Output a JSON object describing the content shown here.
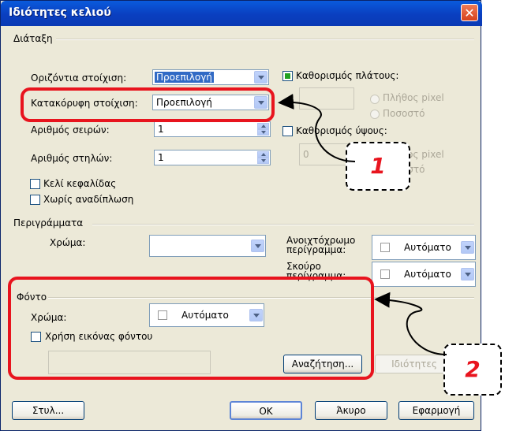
{
  "window": {
    "title": "Ιδιότητες κελιού",
    "close_icon": "close-icon"
  },
  "layout_section": {
    "heading": "Διάταξη",
    "horizontal_align": {
      "label": "Οριζόντια στοίχιση:",
      "value": "Προεπιλογή"
    },
    "vertical_align": {
      "label": "Κατακόρυφη στοίχιση:",
      "value": "Προεπιλογή"
    },
    "rows": {
      "label": "Αριθμός σειρών:",
      "value": "1"
    },
    "cols": {
      "label": "Αριθμός στηλών:",
      "value": "1"
    },
    "header_cell": {
      "label": "Κελί κεφαλίδας",
      "checked": false
    },
    "no_wrap": {
      "label": "Χωρίς αναδίπλωση",
      "checked": false
    },
    "set_width": {
      "label": "Καθορισμός πλάτους:",
      "checked": true,
      "value": ""
    },
    "width_pixels": "Πλήθος pixel",
    "width_percent": "Ποσοστό",
    "set_height": {
      "label": "Καθορισμός ύψους:",
      "checked": false,
      "value": "0"
    },
    "height_pixels": "Πλήθος pixel",
    "height_percent": "Ποσοστό"
  },
  "borders_section": {
    "heading": "Περιγράμματα",
    "color": {
      "label": "Χρώμα:",
      "value": ""
    },
    "light_border": {
      "label_line1": "Ανοιχτόχρωμο",
      "label_line2": "περίγραμμα:",
      "value": "Αυτόματο"
    },
    "dark_border": {
      "label_line1": "Σκούρο",
      "label_line2": "περίγραμμα:",
      "value": "Αυτόματο"
    }
  },
  "background_section": {
    "heading": "Φόντο",
    "color": {
      "label": "Χρώμα:",
      "value": "Αυτόματο"
    },
    "use_image": {
      "label": "Χρήση εικόνας φόντου",
      "checked": false
    },
    "image_path": "",
    "browse_button": "Αναζήτηση...",
    "properties_button": "Ιδιότητες"
  },
  "footer": {
    "style": "Στυλ...",
    "ok": "OK",
    "cancel": "Άκυρο",
    "apply": "Εφαρμογή"
  },
  "callouts": [
    {
      "number": "1"
    },
    {
      "number": "2"
    }
  ],
  "colors": {
    "highlight": "#E8141E",
    "titlebar": "#0A5BDC",
    "dialog_bg": "#ECE9D8"
  }
}
